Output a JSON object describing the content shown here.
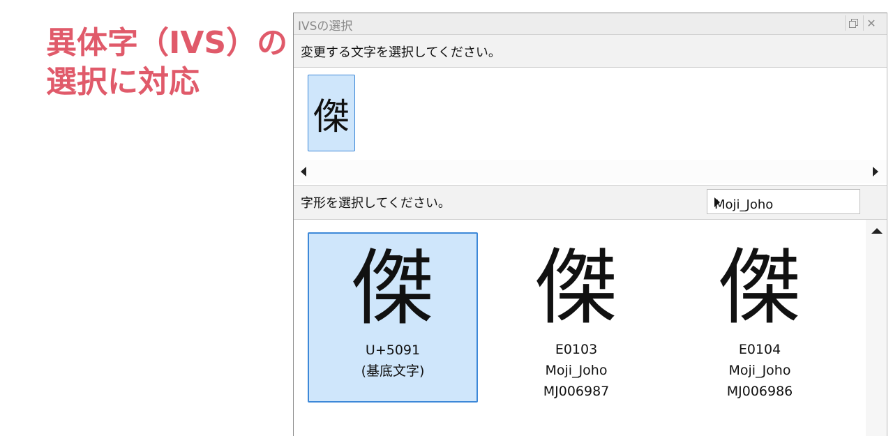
{
  "headline": {
    "line1": "異体字（IVS）の",
    "line2": "選択に対応"
  },
  "dialog": {
    "title": "IVSの選択",
    "restore_icon": "restore-window-icon",
    "close_glyph": "✕"
  },
  "char_section": {
    "prompt": "変更する文字を選択してください。",
    "characters": [
      "傑"
    ]
  },
  "glyph_section": {
    "prompt": "字形を選択してください。",
    "collection": "Moji_Joho",
    "glyphs": [
      {
        "char": "傑",
        "line1": "U+5091",
        "line2": "(基底文字)",
        "line3": "",
        "selected": true
      },
      {
        "char": "傑",
        "line1": "E0103",
        "line2": "Moji_Joho",
        "line3": "MJ006987",
        "selected": false
      },
      {
        "char": "傑",
        "line1": "E0104",
        "line2": "Moji_Joho",
        "line3": "MJ006986",
        "selected": false
      }
    ]
  },
  "colors": {
    "headline": "#e05a6a",
    "selection_fill": "#cfe6fb",
    "selection_border": "#3d88d8"
  }
}
